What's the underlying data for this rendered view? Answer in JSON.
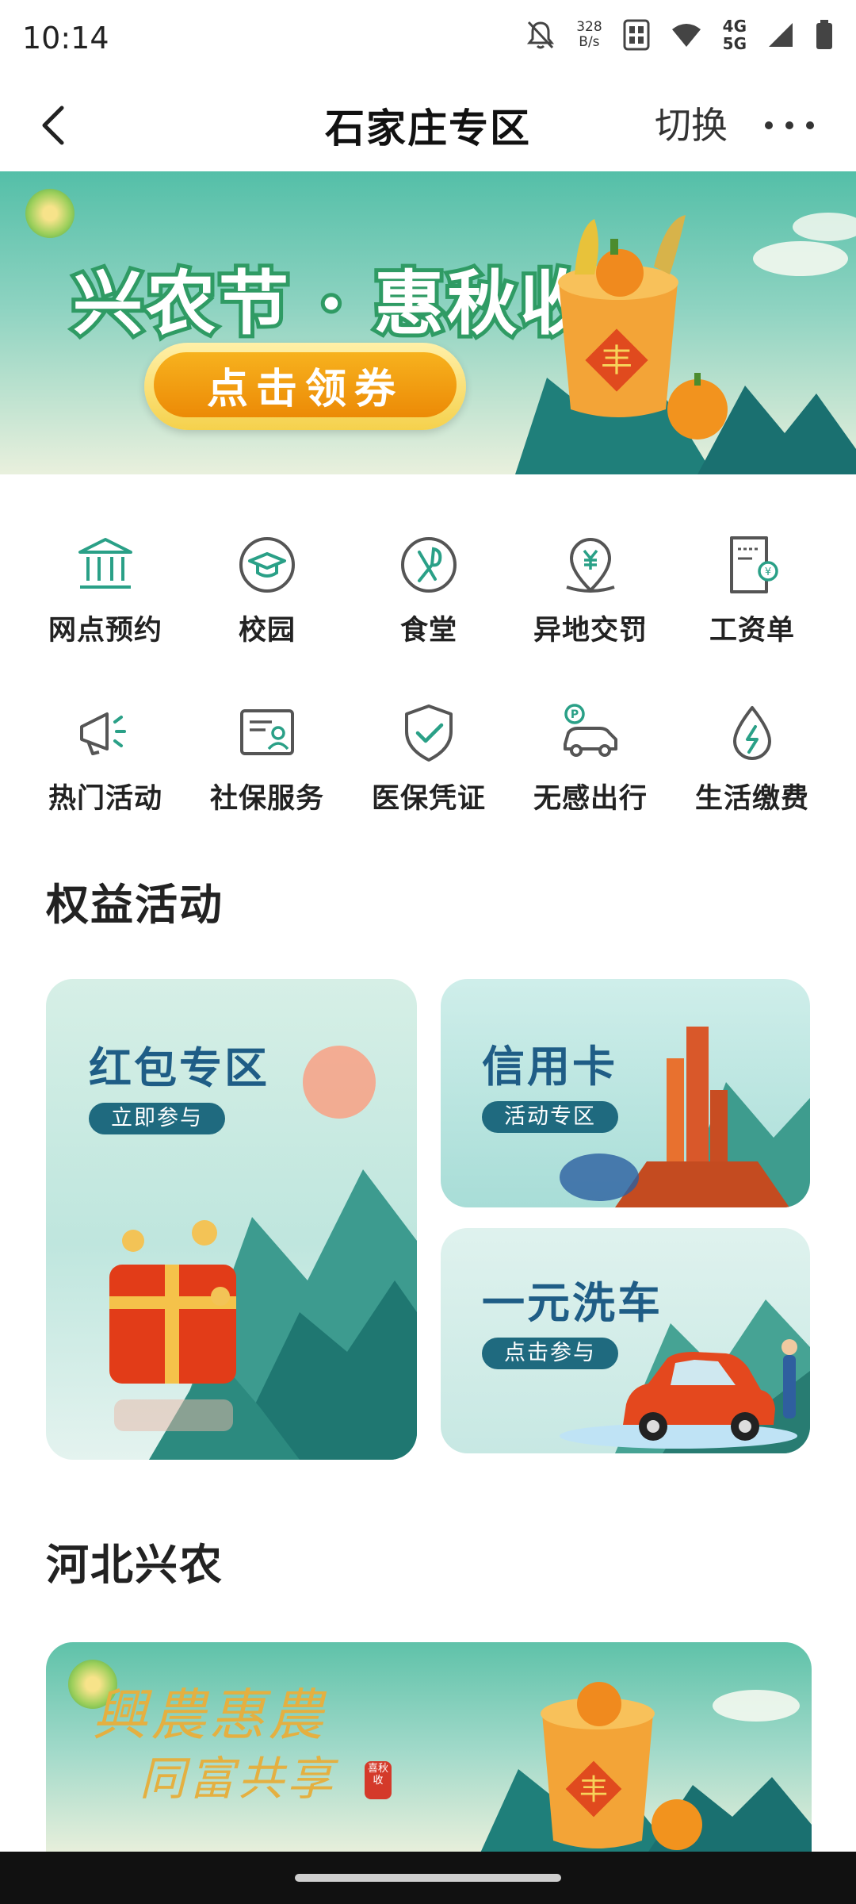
{
  "status_bar": {
    "time": "10:14",
    "speed_value": "328",
    "speed_unit": "B/s",
    "net_top": "4G",
    "net_bottom": "5G"
  },
  "nav": {
    "title": "石家庄专区",
    "switch_label": "切换"
  },
  "banner": {
    "headline_left": "兴农节",
    "dot": "·",
    "headline_right": "惠秋收",
    "coupon_label": "点击领券",
    "basket_mark": "丰"
  },
  "services": [
    {
      "label": "网点预约",
      "icon": "bank-icon"
    },
    {
      "label": "校园",
      "icon": "graduation-cap-icon"
    },
    {
      "label": "食堂",
      "icon": "cutlery-icon"
    },
    {
      "label": "异地交罚",
      "icon": "yuan-location-icon"
    },
    {
      "label": "工资单",
      "icon": "payslip-icon"
    },
    {
      "label": "热门活动",
      "icon": "megaphone-icon"
    },
    {
      "label": "社保服务",
      "icon": "social-security-card-icon"
    },
    {
      "label": "医保凭证",
      "icon": "shield-check-icon"
    },
    {
      "label": "无感出行",
      "icon": "parking-car-icon"
    },
    {
      "label": "生活缴费",
      "icon": "utility-drop-icon"
    }
  ],
  "rights_section": {
    "title": "权益活动",
    "cards": [
      {
        "title": "红包专区",
        "button": "立即参与"
      },
      {
        "title": "信用卡",
        "button": "活动专区"
      },
      {
        "title": "一元洗车",
        "button": "点击参与"
      }
    ]
  },
  "hebei_section": {
    "title": "河北兴农",
    "calligraphy_line1": "興農惠農",
    "calligraphy_line2": "同富共享",
    "seal": "喜秋收",
    "basket_mark": "丰"
  },
  "colors": {
    "brand_green": "#2f9b64",
    "card_title_blue": "#1f5d86",
    "card_button": "#1f6a7f",
    "icon_teal": "#2aa087"
  }
}
